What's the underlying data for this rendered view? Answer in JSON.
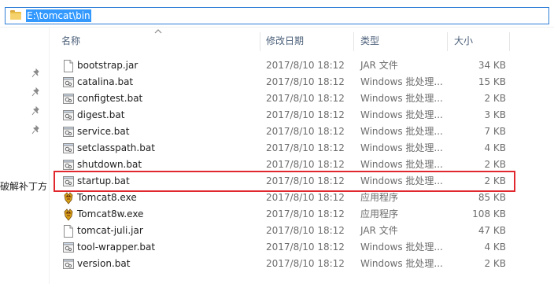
{
  "address": {
    "path": "E:\\tomcat\\bin",
    "folder_icon": "folder-icon"
  },
  "sidebar": {
    "label": "破解补丁方",
    "pins": [
      "pin-icon",
      "pin-icon",
      "pin-icon",
      "pin-icon"
    ]
  },
  "columns": {
    "name": "名称",
    "date": "修改日期",
    "type": "类型",
    "size": "大小"
  },
  "files": [
    {
      "name": "bootstrap.jar",
      "date": "2017/8/10 18:12",
      "type": "JAR 文件",
      "size": "34 KB",
      "icon": "jar"
    },
    {
      "name": "catalina.bat",
      "date": "2017/8/10 18:12",
      "type": "Windows 批处理...",
      "size": "15 KB",
      "icon": "bat"
    },
    {
      "name": "configtest.bat",
      "date": "2017/8/10 18:12",
      "type": "Windows 批处理...",
      "size": "2 KB",
      "icon": "bat"
    },
    {
      "name": "digest.bat",
      "date": "2017/8/10 18:12",
      "type": "Windows 批处理...",
      "size": "3 KB",
      "icon": "bat"
    },
    {
      "name": "service.bat",
      "date": "2017/8/10 18:12",
      "type": "Windows 批处理...",
      "size": "7 KB",
      "icon": "bat"
    },
    {
      "name": "setclasspath.bat",
      "date": "2017/8/10 18:12",
      "type": "Windows 批处理...",
      "size": "4 KB",
      "icon": "bat"
    },
    {
      "name": "shutdown.bat",
      "date": "2017/8/10 18:12",
      "type": "Windows 批处理...",
      "size": "2 KB",
      "icon": "bat"
    },
    {
      "name": "startup.bat",
      "date": "2017/8/10 18:12",
      "type": "Windows 批处理...",
      "size": "2 KB",
      "icon": "bat",
      "highlighted": true
    },
    {
      "name": "Tomcat8.exe",
      "date": "2017/8/10 18:12",
      "type": "应用程序",
      "size": "85 KB",
      "icon": "exe"
    },
    {
      "name": "Tomcat8w.exe",
      "date": "2017/8/10 18:12",
      "type": "应用程序",
      "size": "108 KB",
      "icon": "exe"
    },
    {
      "name": "tomcat-juli.jar",
      "date": "2017/8/10 18:12",
      "type": "JAR 文件",
      "size": "47 KB",
      "icon": "jar"
    },
    {
      "name": "tool-wrapper.bat",
      "date": "2017/8/10 18:12",
      "type": "Windows 批处理...",
      "size": "4 KB",
      "icon": "bat"
    },
    {
      "name": "version.bat",
      "date": "2017/8/10 18:12",
      "type": "Windows 批处理...",
      "size": "2 KB",
      "icon": "bat"
    }
  ],
  "colors": {
    "highlight_border": "#e0282e",
    "address_selection": "#3399ff",
    "address_border": "#2f7fd8"
  }
}
